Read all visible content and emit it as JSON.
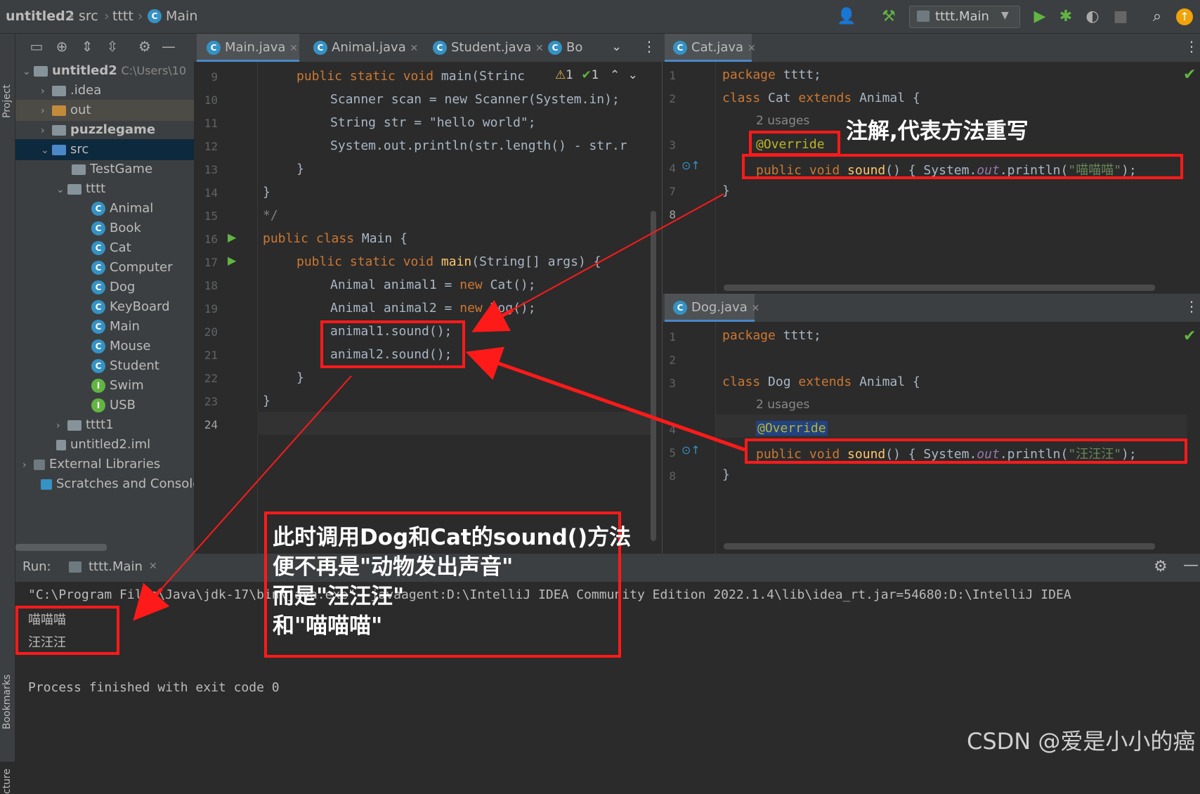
{
  "breadcrumb": {
    "project": "untitled2",
    "src": "src",
    "pkg": "tttt",
    "cls": "Main"
  },
  "toolbar": {
    "run_config": "tttt.Main"
  },
  "side_labels": {
    "project": "Project",
    "bookmarks": "Bookmarks",
    "structure": "cture"
  },
  "project_tree": {
    "root_name": "untitled2",
    "root_path": "C:\\Users\\10",
    "items": [
      ".idea",
      "out",
      "puzzlegame",
      "src",
      "TestGame",
      "tttt",
      "Animal",
      "Book",
      "Cat",
      "Computer",
      "Dog",
      "KeyBoard",
      "Main",
      "Mouse",
      "Student",
      "Swim",
      "USB",
      "tttt1",
      "untitled2.iml",
      "External Libraries",
      "Scratches and Console"
    ]
  },
  "editor_tabs": [
    "Main.java",
    "Animal.java",
    "Student.java",
    "Bo"
  ],
  "inspections": {
    "warnings": "1",
    "ok": "1"
  },
  "main_code": {
    "line_numbers": [
      "9",
      "10",
      "11",
      "12",
      "13",
      "14",
      "15",
      "16",
      "17",
      "18",
      "19",
      "20",
      "21",
      "22",
      "23",
      "24"
    ],
    "l9": "public static void main(String",
    "l10": "Scanner scan = new Scanner(System.in);",
    "l11": "String str = \"hello world\";",
    "l12": "System.out.println(str.length() - str.r",
    "l13": "}",
    "l14": "}",
    "l15": "*/",
    "l16_kw": "public class",
    "l16_rest": " Main {",
    "l17_kw": "public static void",
    "l17_fn": " main",
    "l17_rest": "(String[] args) {",
    "l18_a": "Animal animal1 = ",
    "l18_kw": "new",
    "l18_b": " Cat();",
    "l19_a": "Animal animal2 = ",
    "l19_kw": "new",
    "l19_b": " Dog();",
    "l20": "animal1.sound();",
    "l21": "animal2.sound();",
    "l22": "}",
    "l23": "}"
  },
  "cat_tab": "Cat.java",
  "cat_code": {
    "line_numbers": [
      "1",
      "2",
      "",
      "3",
      "4",
      "7",
      "8"
    ],
    "l1_kw": "package",
    "l1_rest": " tttt;",
    "l2_kw": "class",
    "l2_a": " Cat ",
    "l2_kw2": "extends",
    "l2_b": " Animal {",
    "usages": "2 usages",
    "ann": "@Override",
    "l4_kw": "public void",
    "l4_fn": " sound",
    "l4_a": "() { System.",
    "l4_out": "out",
    "l4_b": ".println(",
    "l4_str": "\"喵喵喵\"",
    "l4_c": ");",
    "l7": "}"
  },
  "dog_tab": "Dog.java",
  "dog_code": {
    "line_numbers": [
      "1",
      "2",
      "3",
      "",
      "4",
      "5",
      "8"
    ],
    "l1_kw": "package",
    "l1_rest": " tttt;",
    "l3_kw": "class",
    "l3_a": " Dog ",
    "l3_kw2": "extends",
    "l3_b": " Animal {",
    "usages": "2 usages",
    "ann": "@Override",
    "l5_kw": "public void",
    "l5_fn": " sound",
    "l5_a": "() { System.",
    "l5_out": "out",
    "l5_b": ".println(",
    "l5_str": "\"汪汪汪\"",
    "l5_c": ");",
    "l8": "}"
  },
  "run": {
    "label": "Run:",
    "tab": "tttt.Main",
    "cmd": "\"C:\\Program Files\\Java\\jdk-17\\bin\\java.exe\" -javaagent:D:\\IntelliJ IDEA Community Edition 2022.1.4\\lib\\idea_rt.jar=54680:D:\\IntelliJ IDEA",
    "out1": "喵喵喵",
    "out2": "汪汪汪",
    "exit": "Process finished with exit code 0"
  },
  "annotations": {
    "override_note": "注解,代表方法重写",
    "explain1": "此时调用Dog和Cat的sound()方法",
    "explain2": "便不再是\"动物发出声音\"",
    "explain3": "而是\"汪汪汪\"",
    "explain4": "和\"喵喵喵\""
  },
  "watermark": "CSDN @爱是小小的癌",
  "colors": {
    "accent": "#4a88c7",
    "annotation_red": "#ff1a1a",
    "keyword": "#cc7832",
    "string": "#6a8759"
  }
}
